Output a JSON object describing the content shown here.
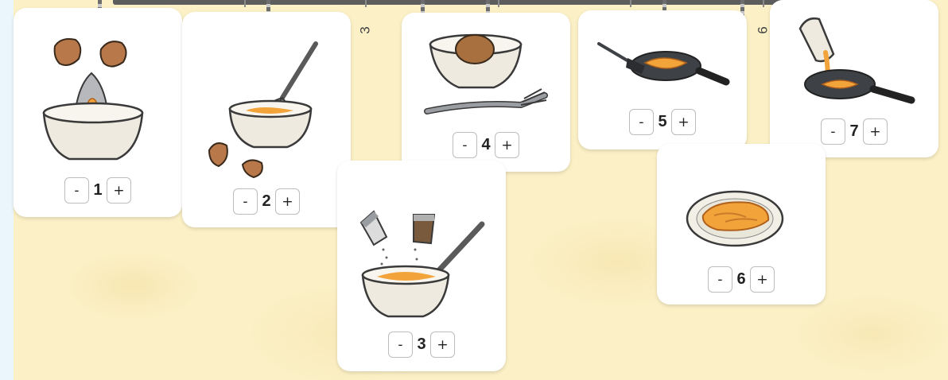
{
  "board": {
    "background_numbers": [
      "3",
      "6"
    ],
    "steps": [
      {
        "number": "1",
        "minus": "-",
        "plus": "+",
        "picture": "cracking egg into bowl"
      },
      {
        "number": "2",
        "minus": "-",
        "plus": "+",
        "picture": "whisking eggs in bowl"
      },
      {
        "number": "3",
        "minus": "-",
        "plus": "+",
        "picture": "seasoning with salt and pepper"
      },
      {
        "number": "4",
        "minus": "-",
        "plus": "+",
        "picture": "bowl with fork"
      },
      {
        "number": "5",
        "minus": "-",
        "plus": "+",
        "picture": "cooking in pan with spatula"
      },
      {
        "number": "6",
        "minus": "-",
        "plus": "+",
        "picture": "omelette served on plate"
      },
      {
        "number": "7",
        "minus": "-",
        "plus": "+",
        "picture": "pouring eggs into pan"
      }
    ]
  },
  "colors": {
    "board_bg": "#fbf0c6",
    "page_bg": "#eaf6fb",
    "egg_shell": "#b8784a",
    "egg_yolk": "#f2a33a",
    "bowl": "#eeeae0",
    "pan": "#3e4145"
  }
}
